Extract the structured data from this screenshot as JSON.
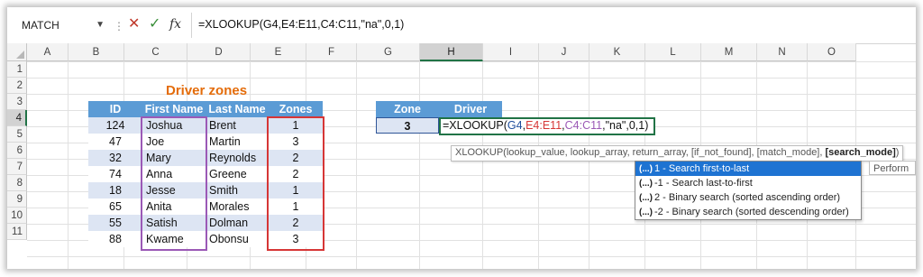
{
  "formula_bar": {
    "name_box": "MATCH",
    "fx_label": "fx",
    "formula": "=XLOOKUP(G4,E4:E11,C4:C11,\"na\",0,1)"
  },
  "columns": [
    "A",
    "B",
    "C",
    "D",
    "E",
    "F",
    "G",
    "H",
    "I",
    "J",
    "K",
    "L",
    "M",
    "N",
    "O"
  ],
  "rows": [
    "1",
    "2",
    "3",
    "4",
    "5",
    "6",
    "7",
    "8",
    "9",
    "10",
    "11"
  ],
  "table_title": "Driver zones",
  "table_headers": [
    "ID",
    "First Name",
    "Last Name",
    "Zones"
  ],
  "table_rows": [
    [
      "124",
      "Joshua",
      "Brent",
      "1"
    ],
    [
      "47",
      "Joe",
      "Martin",
      "3"
    ],
    [
      "32",
      "Mary",
      "Reynolds",
      "2"
    ],
    [
      "74",
      "Anna",
      "Greene",
      "2"
    ],
    [
      "18",
      "Jesse",
      "Smith",
      "1"
    ],
    [
      "65",
      "Anita",
      "Morales",
      "1"
    ],
    [
      "55",
      "Satish",
      "Dolman",
      "2"
    ],
    [
      "88",
      "Kwame",
      "Obonsu",
      "3"
    ]
  ],
  "lookup": {
    "zone_header": "Zone",
    "driver_header": "Driver",
    "zone_value": "3",
    "edit_parts": [
      "=XLOOKUP(",
      "G4",
      ",",
      "E4:E11",
      ",",
      "C4:C11",
      ",\"na\",0,1)"
    ]
  },
  "tooltip": {
    "text": "XLOOKUP(lookup_value, lookup_array, return_array, [if_not_found], [match_mode], ",
    "bold": "[search_mode]",
    "close": ")"
  },
  "autocomplete": {
    "items": [
      {
        "icon": "(...)",
        "label": "1 - Search first-to-last",
        "active": true
      },
      {
        "icon": "(...)",
        "label": "-1 - Search last-to-first",
        "active": false
      },
      {
        "icon": "(...)",
        "label": "2 - Binary search (sorted ascending order)",
        "active": false
      },
      {
        "icon": "(...)",
        "label": "-2 - Binary search (sorted descending order)",
        "active": false
      }
    ],
    "perform_tip": "Perform"
  },
  "colors": {
    "header_blue": "#5b9bd5",
    "band_blue": "#dde5f3",
    "title_orange": "#e46c0a",
    "purple_ref": "#9b59b6",
    "red_ref": "#d63636",
    "green_ref": "#3a8f3a",
    "blue_ref": "#1f4e9c"
  }
}
